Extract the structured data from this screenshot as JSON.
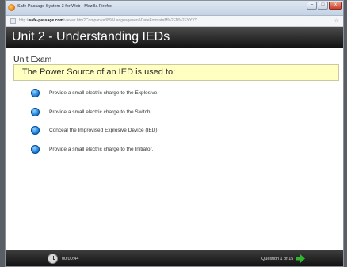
{
  "window": {
    "title": "Safe Passage System 3 for Web - Mozilla Firefox",
    "min_glyph": "–",
    "max_glyph": "□",
    "close_glyph": "x"
  },
  "browser": {
    "url_prefix": "http://",
    "url_domain": "safe-passage.com",
    "url_rest": "/viewer.htm?Company=389&Language=en&DateFormat=M%2FD%2FYYYY"
  },
  "header": {
    "title": "Unit 2 - Understanding IEDs"
  },
  "exam": {
    "section_label": "Unit Exam",
    "question": "The Power Source of an IED is used to:",
    "options": [
      "Provide a small electric charge to the Explosive.",
      "Provide a small electric charge to the Switch.",
      "Conceal the Improvised Explosive Device (IED).",
      "Provide a small electric charge to the Initiator."
    ]
  },
  "footer": {
    "timer": "00:00:44",
    "question_counter": "Question 1 of 15"
  },
  "icons": {
    "favicon": "firefox-icon",
    "clock": "clock-icon",
    "next": "next-arrow-icon"
  },
  "colors": {
    "header_bg": "#1a1a1a",
    "question_bg": "#ffffc2",
    "radio": "#1f7fd6",
    "next_arrow": "#2fb52f"
  }
}
